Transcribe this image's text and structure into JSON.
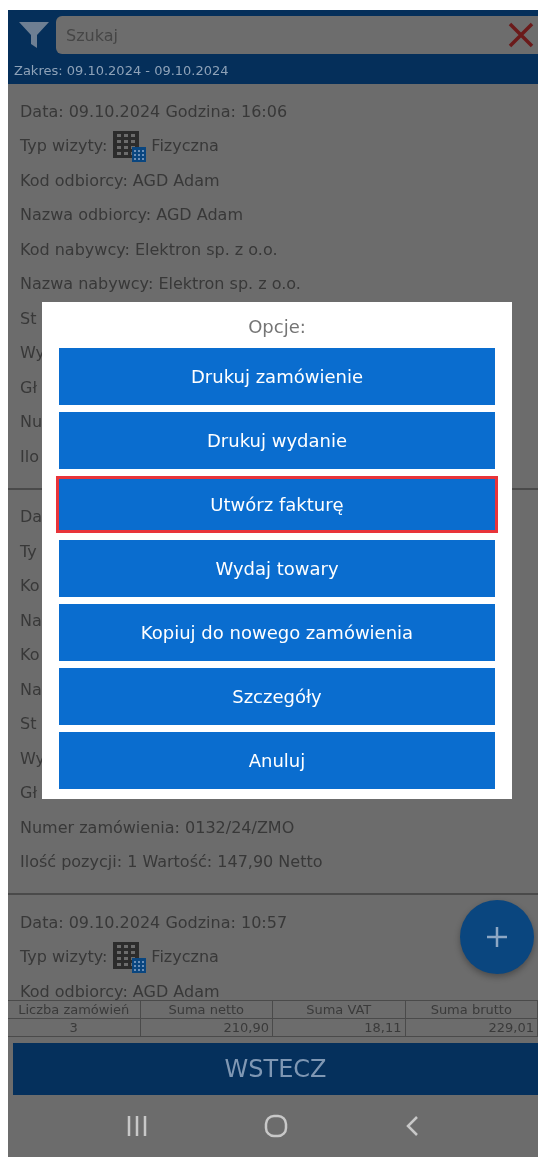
{
  "search": {
    "placeholder": "Szukaj"
  },
  "range": "Zakres: 09.10.2024 - 09.10.2024",
  "records": [
    {
      "lines": [
        {
          "kind": "text",
          "text": "Data:  09.10.2024 Godzina:  16:06"
        },
        {
          "kind": "visit",
          "label": "Typ wizyty:",
          "value": "Fizyczna"
        },
        {
          "kind": "text",
          "text": "Kod odbiorcy:  AGD Adam"
        },
        {
          "kind": "text",
          "text": "Nazwa odbiorcy:  AGD Adam"
        },
        {
          "kind": "text",
          "text": "Kod nabywcy:  Elektron sp. z o.o."
        },
        {
          "kind": "text",
          "text": "Nazwa nabywcy:  Elektron sp. z o.o."
        },
        {
          "kind": "text",
          "text": "St"
        },
        {
          "kind": "text",
          "text": "Wy"
        },
        {
          "kind": "text",
          "text": "Gł"
        },
        {
          "kind": "text",
          "text": "Nu"
        },
        {
          "kind": "text",
          "text": "Ilo"
        }
      ]
    },
    {
      "lines": [
        {
          "kind": "text",
          "text": "Da"
        },
        {
          "kind": "text",
          "text": "Ty"
        },
        {
          "kind": "text",
          "text": "Ko"
        },
        {
          "kind": "text",
          "text": "Na"
        },
        {
          "kind": "text",
          "text": "Ko"
        },
        {
          "kind": "text",
          "text": "Na"
        },
        {
          "kind": "text",
          "text": "St"
        },
        {
          "kind": "text",
          "text": "Wy"
        },
        {
          "kind": "text",
          "text": "Gł"
        },
        {
          "kind": "text",
          "text": "Numer zamówienia:  0132/24/ZMO"
        },
        {
          "kind": "text",
          "text": "Ilość pozycji:  1  Wartość:   147,90 Netto"
        }
      ]
    },
    {
      "lines": [
        {
          "kind": "text",
          "text": "Data:  09.10.2024 Godzina:  10:57"
        },
        {
          "kind": "visit",
          "label": "Typ wizyty:",
          "value": "Fizyczna"
        },
        {
          "kind": "text",
          "text": "Kod odbiorcy:  AGD Adam"
        }
      ]
    }
  ],
  "summary": {
    "columns": [
      "Liczba zamówień",
      "Suma netto",
      "Suma VAT",
      "Suma brutto"
    ],
    "values": [
      "3",
      "210,90",
      "18,11",
      "229,01"
    ]
  },
  "back_button": "WSTECZ",
  "dialog": {
    "title": "Opcje:",
    "options": [
      {
        "label": "Drukuj zamówienie",
        "selected": false
      },
      {
        "label": "Drukuj wydanie",
        "selected": false
      },
      {
        "label": "Utwórz fakturę",
        "selected": true
      },
      {
        "label": "Wydaj towary",
        "selected": false
      },
      {
        "label": "Kopiuj do nowego zamówienia",
        "selected": false
      },
      {
        "label": "Szczegóły",
        "selected": false
      },
      {
        "label": "Anuluj",
        "selected": false
      }
    ]
  }
}
